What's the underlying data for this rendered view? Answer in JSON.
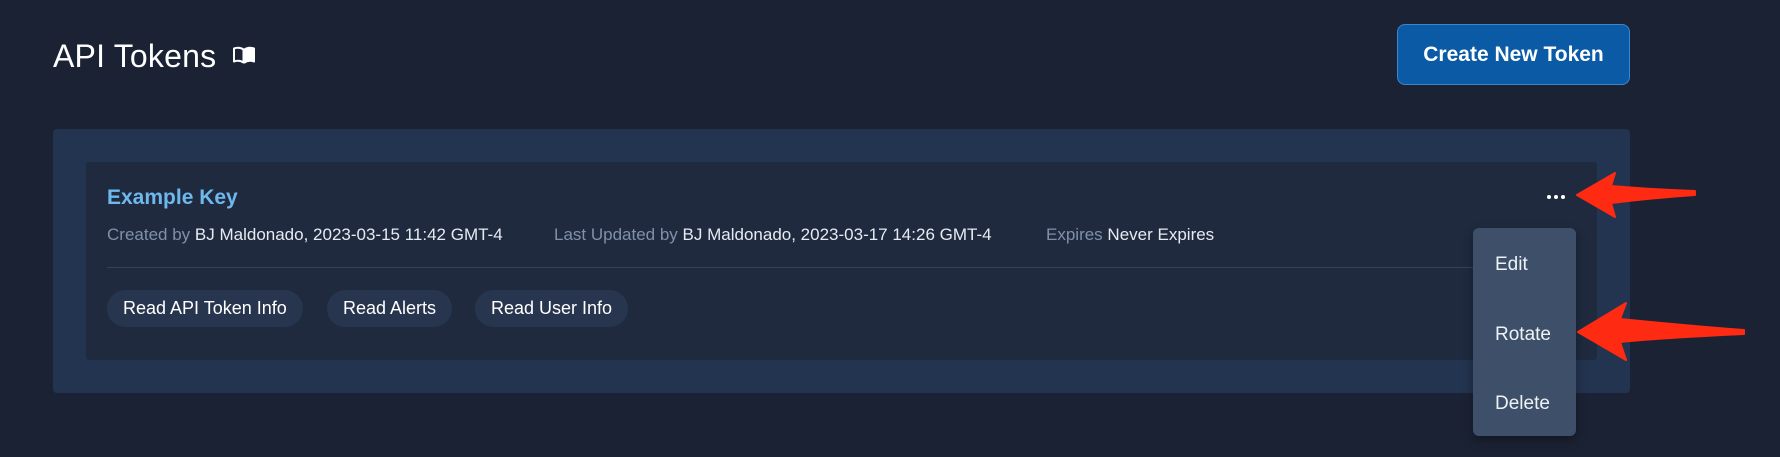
{
  "header": {
    "title": "API Tokens",
    "docs_icon": "book-open-icon",
    "create_button_label": "Create New Token"
  },
  "token": {
    "name": "Example Key",
    "created_label": "Created by",
    "created_value": "BJ Maldonado, 2023-03-15 11:42 GMT-4",
    "updated_label": "Last Updated by",
    "updated_value": "BJ Maldonado, 2023-03-17 14:26 GMT-4",
    "expires_label": "Expires",
    "expires_value": "Never Expires",
    "scopes": [
      "Read API Token Info",
      "Read Alerts",
      "Read User Info"
    ]
  },
  "actions_menu": {
    "icon": "more-horizontal-icon",
    "items": [
      "Edit",
      "Rotate",
      "Delete"
    ]
  },
  "annotations": {
    "arrow_color": "#ff2a12",
    "arrow_icon": "red-arrow-annotation"
  },
  "colors": {
    "background": "#1b2233",
    "panel": "#233450",
    "card": "#1f2a3f",
    "accent_link": "#6fb8ee",
    "primary_button": "#0a5aa6",
    "menu": "#3e5069"
  }
}
